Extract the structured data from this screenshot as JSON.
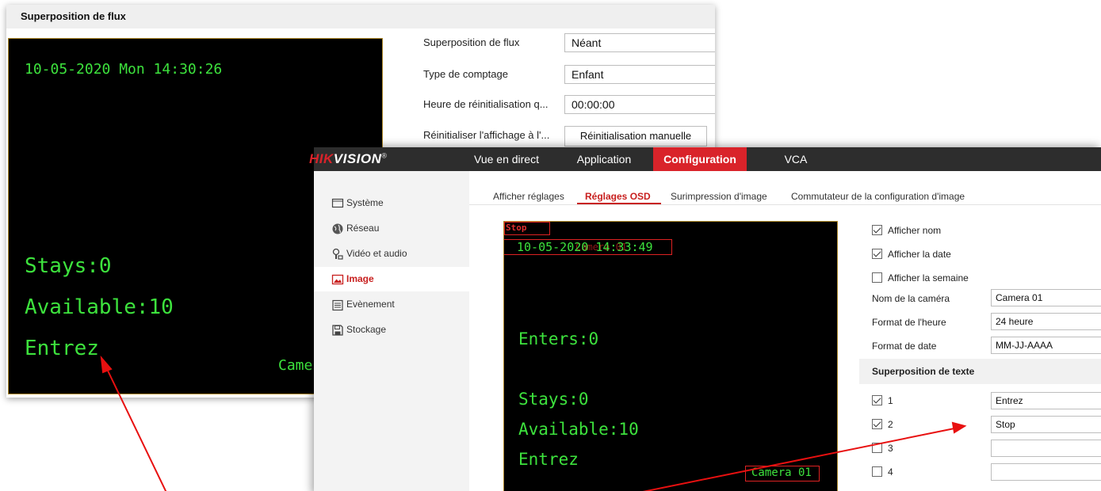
{
  "back": {
    "header": "Superposition de flux",
    "video": {
      "date": "10-05-2020 Mon 14:30:26",
      "stays": "Stays:0",
      "available": "Available:10",
      "entrez": "Entrez",
      "camera": "Came"
    },
    "form": {
      "overlay_label": "Superposition de flux",
      "overlay_value": "Néant",
      "count_type_label": "Type de comptage",
      "count_type_value": "Enfant",
      "reset_time_label": "Heure de réinitialisation q...",
      "reset_time_value": "00:00:00",
      "reset_display_label": "Réinitialiser l'affichage à l'...",
      "reset_button": "Réinitialisation manuelle"
    }
  },
  "front": {
    "logo": {
      "hik": "HIK",
      "vision": "VISION",
      "reg": "®"
    },
    "nav": [
      "Vue en direct",
      "Application",
      "Configuration",
      "VCA"
    ],
    "sidebar": [
      {
        "label": "Système",
        "icon": "monitor-icon"
      },
      {
        "label": "Réseau",
        "icon": "globe-icon"
      },
      {
        "label": "Vidéo et audio",
        "icon": "mic-camera-icon"
      },
      {
        "label": "Image",
        "icon": "image-icon"
      },
      {
        "label": "Evènement",
        "icon": "calendar-icon"
      },
      {
        "label": "Stockage",
        "icon": "floppy-icon"
      }
    ],
    "subtabs": [
      "Afficher réglages",
      "Réglages OSD",
      "Surimpression d'image",
      "Commutateur de la configuration d'image"
    ],
    "video": {
      "stop_tag": "Stop",
      "date": "10-05-2020 14:33:49",
      "name_ghost": "Camera 01",
      "enters": "Enters:0",
      "stays": "Stays:0",
      "available": "Available:10",
      "entrez": "Entrez",
      "camera": "Camera 01"
    },
    "settings": {
      "show_name": "Afficher nom",
      "show_date": "Afficher la date",
      "show_week": "Afficher la semaine",
      "camera_name_label": "Nom de la caméra",
      "camera_name_value": "Camera 01",
      "time_format_label": "Format de l'heure",
      "time_format_value": "24 heure",
      "date_format_label": "Format de date",
      "date_format_value": "MM-JJ-AAAA",
      "text_overlay_head": "Superposition de texte",
      "rows": [
        {
          "num": "1",
          "value": "Entrez",
          "checked": true
        },
        {
          "num": "2",
          "value": "Stop",
          "checked": true
        },
        {
          "num": "3",
          "value": "",
          "checked": false
        },
        {
          "num": "4",
          "value": "",
          "checked": false
        }
      ]
    }
  },
  "colors": {
    "accent": "#d9232a",
    "osd_green": "#3de23d",
    "arrow": "#e81010"
  }
}
